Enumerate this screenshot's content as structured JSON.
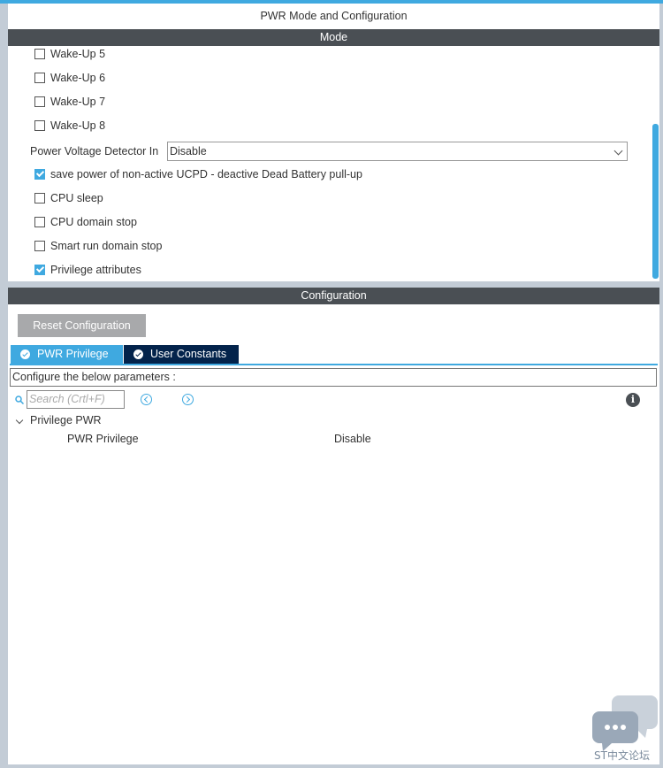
{
  "window": {
    "title": "PWR Mode and Configuration"
  },
  "mode": {
    "header": "Mode",
    "checkboxes": [
      {
        "label": "Wake-Up 5",
        "checked": false
      },
      {
        "label": "Wake-Up 6",
        "checked": false
      },
      {
        "label": "Wake-Up 7",
        "checked": false
      },
      {
        "label": "Wake-Up 8",
        "checked": false
      }
    ],
    "pvd": {
      "label": "Power Voltage Detector In",
      "value": "Disable"
    },
    "options": [
      {
        "label": "save power of non-active UCPD - deactive Dead Battery pull-up",
        "checked": true
      },
      {
        "label": "CPU sleep",
        "checked": false
      },
      {
        "label": "CPU domain stop",
        "checked": false
      },
      {
        "label": "Smart run domain stop",
        "checked": false
      },
      {
        "label": "Privilege attributes",
        "checked": true
      }
    ]
  },
  "configuration": {
    "header": "Configuration",
    "reset_label": "Reset Configuration",
    "tabs": [
      {
        "label": "PWR Privilege",
        "active": true
      },
      {
        "label": "User Constants",
        "active": false
      }
    ],
    "params_label": "Configure the below parameters :",
    "search_placeholder": "Search (Crtl+F)",
    "tree": {
      "group": "Privilege PWR",
      "param": "PWR Privilege",
      "value": "Disable"
    }
  },
  "watermark": {
    "text": "ST中文论坛"
  },
  "colors": {
    "accent": "#3fa9e0",
    "header_bg": "#4a4f54",
    "tab_inactive": "#03234b",
    "button_bg": "#a8a9ab"
  }
}
